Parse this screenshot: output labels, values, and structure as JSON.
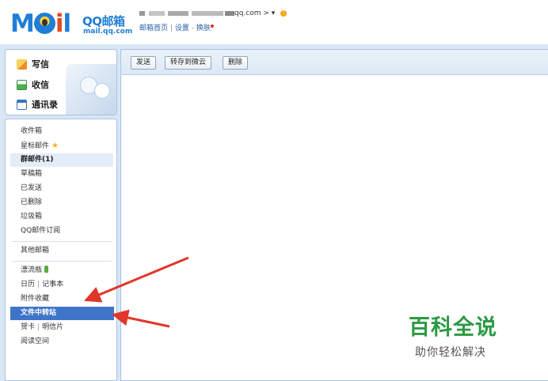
{
  "brand": {
    "logo_text": "MOil",
    "product_name": "QQ邮箱",
    "domain": "mail.qq.com"
  },
  "account": {
    "email_suffix": "qq.com",
    "menu_caret": "> ▾"
  },
  "header_links": {
    "home": "邮箱首页",
    "separator": "|",
    "settings": "设置",
    "dash": "-",
    "skin": "换肤"
  },
  "quick_actions": [
    {
      "label": "写信",
      "icon": "pencil-paper-icon"
    },
    {
      "label": "收信",
      "icon": "inbox-tray-icon"
    },
    {
      "label": "通讯录",
      "icon": "address-book-icon"
    }
  ],
  "folders": [
    {
      "label": "收件箱"
    },
    {
      "label": "星标邮件"
    },
    {
      "label": "群邮件(1)"
    },
    {
      "label": "草稿箱"
    },
    {
      "label": "已发送"
    },
    {
      "label": "已删除"
    },
    {
      "label": "垃圾箱"
    },
    {
      "label": "QQ邮件订阅"
    },
    {
      "label": "其他邮箱"
    },
    {
      "label": "漂流瓶"
    },
    {
      "label": "日历",
      "label2": "记事本"
    },
    {
      "label": "附件收藏"
    },
    {
      "label": "文件中转站"
    },
    {
      "label": "贺卡",
      "label2": "明信片"
    },
    {
      "label": "阅读空间"
    }
  ],
  "toolbar": {
    "send": "发送",
    "save_to_cloud": "转存到微云",
    "delete": "删除"
  },
  "watermark": {
    "title": "百科全说",
    "subtitle": "助你轻松解决"
  },
  "colors": {
    "accent_blue": "#3f75c8",
    "frame_blue": "#d8e6f5",
    "annotation_red": "#e0362a",
    "watermark_green": "#2a9a42"
  }
}
